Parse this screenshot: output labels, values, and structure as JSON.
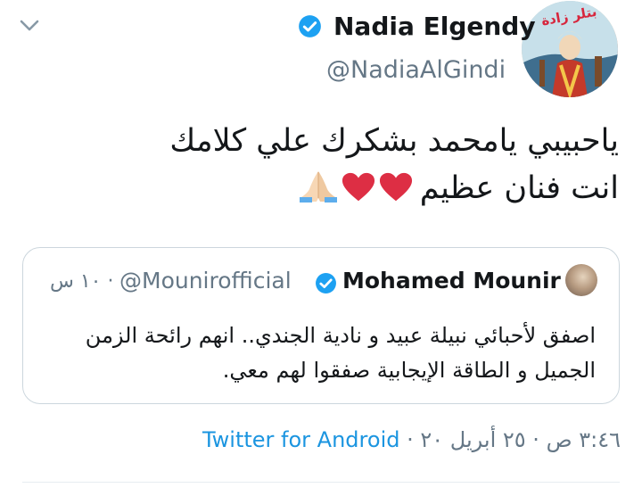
{
  "tweet": {
    "author_name": "Nadia Elgendy",
    "author_handle": "@NadiaAlGindi",
    "text_lines": [
      "ياحبيبي يامحمد بشكرك علي كلامك",
      "انت فنان عظيم"
    ],
    "emojis": [
      "red-heart",
      "red-heart",
      "folded-hands"
    ],
    "menu_icon": "chevron-down-icon",
    "verified_icon": "verified-badge-icon",
    "avatar_text": "بتلر زادة"
  },
  "quote": {
    "author_name": "Mohamed Mounir",
    "author_handle": "@Mounirofficial",
    "time": "· ١٠ س",
    "text_lines": [
      "اصفق لأحبائي نبيلة عبيد و نادية الجندي.. انهم رائحة الزمن",
      "الجميل و الطاقة الإيجابية صفقوا لهم معي."
    ]
  },
  "meta": {
    "time": "٣:٤٦ ص",
    "date": "٢٥ أبريل ٢٠",
    "source": "Twitter for Android",
    "separator": "·"
  },
  "colors": {
    "text": "#14171a",
    "secondary": "#657786",
    "link": "#1b95e0",
    "verified": "#1da1f2",
    "border": "#ccd6dd"
  }
}
